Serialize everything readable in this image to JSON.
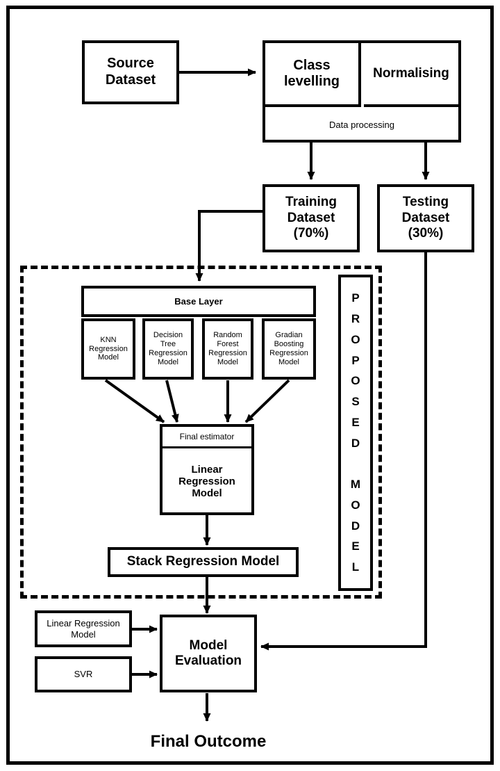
{
  "diagram": {
    "title_caption": "Final Outcome",
    "outer_frame": "diagram-border",
    "dashed_group_label": "PROPOSED MODEL"
  },
  "nodes": {
    "source_dataset": "Source\nDataset",
    "class_levelling": "Class\nlevelling",
    "normalising": "Normalising",
    "data_processing": "Data processing",
    "training_dataset": "Training\nDataset\n(70%)",
    "testing_dataset": "Testing\nDataset\n(30%)",
    "base_layer": "Base Layer",
    "knn_model": "KNN\nRegression\nModel",
    "decision_tree_model": "Decision\nTree\nRegression\nModel",
    "random_forest_model": "Random\nForest\nRegression\nModel",
    "gradian_boosting_model": "Gradian\nBoosting\nRegression\nModel",
    "final_estimator_header": "Final estimator",
    "final_estimator_body": "Linear\nRegression\nModel",
    "stack_regression_model": "Stack Regression Model",
    "proposed_model": "P\nR\nO\nP\nO\nS\nE\nD\n\nM\nO\nD\nE\nL",
    "linear_regression_model": "Linear Regression\nModel",
    "svr": "SVR",
    "model_evaluation": "Model\nEvaluation",
    "final_outcome": "Final Outcome"
  },
  "colors": {
    "stroke": "#000000",
    "fill": "#ffffff",
    "background": "#ffffff"
  }
}
